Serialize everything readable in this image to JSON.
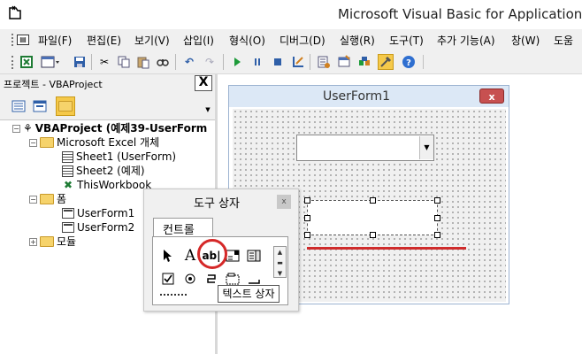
{
  "window": {
    "title": "Microsoft Visual Basic for Applications -"
  },
  "menu": [
    {
      "label": "파일(F)"
    },
    {
      "label": "편집(E)"
    },
    {
      "label": "보기(V)"
    },
    {
      "label": "삽입(I)"
    },
    {
      "label": "형식(O)"
    },
    {
      "label": "디버그(D)"
    },
    {
      "label": "실행(R)"
    },
    {
      "label": "도구(T)"
    },
    {
      "label": "추가 기능(A)"
    },
    {
      "label": "창(W)"
    },
    {
      "label": "도움"
    }
  ],
  "project_pane": {
    "title": "프로젝트 - VBAProject",
    "close_label": "X",
    "tree": [
      {
        "label": "VBAProject (예제39-UserForm"
      },
      {
        "label": "Microsoft Excel 개체"
      },
      {
        "label": "Sheet1 (UserForm)"
      },
      {
        "label": "Sheet2 (예제)"
      },
      {
        "label": "ThisWorkbook"
      },
      {
        "label": "폼"
      },
      {
        "label": "UserForm1"
      },
      {
        "label": "UserForm2"
      },
      {
        "label": "모듈"
      }
    ]
  },
  "userform": {
    "title": "UserForm1",
    "close_label": "x"
  },
  "toolbox": {
    "title": "도구 상자",
    "close_label": "x",
    "tab_label": "컨트롤",
    "tools_row1": [
      "A",
      "ab|"
    ],
    "tooltip": "텍스트 상자"
  },
  "colors": {
    "highlight": "#d52828"
  }
}
